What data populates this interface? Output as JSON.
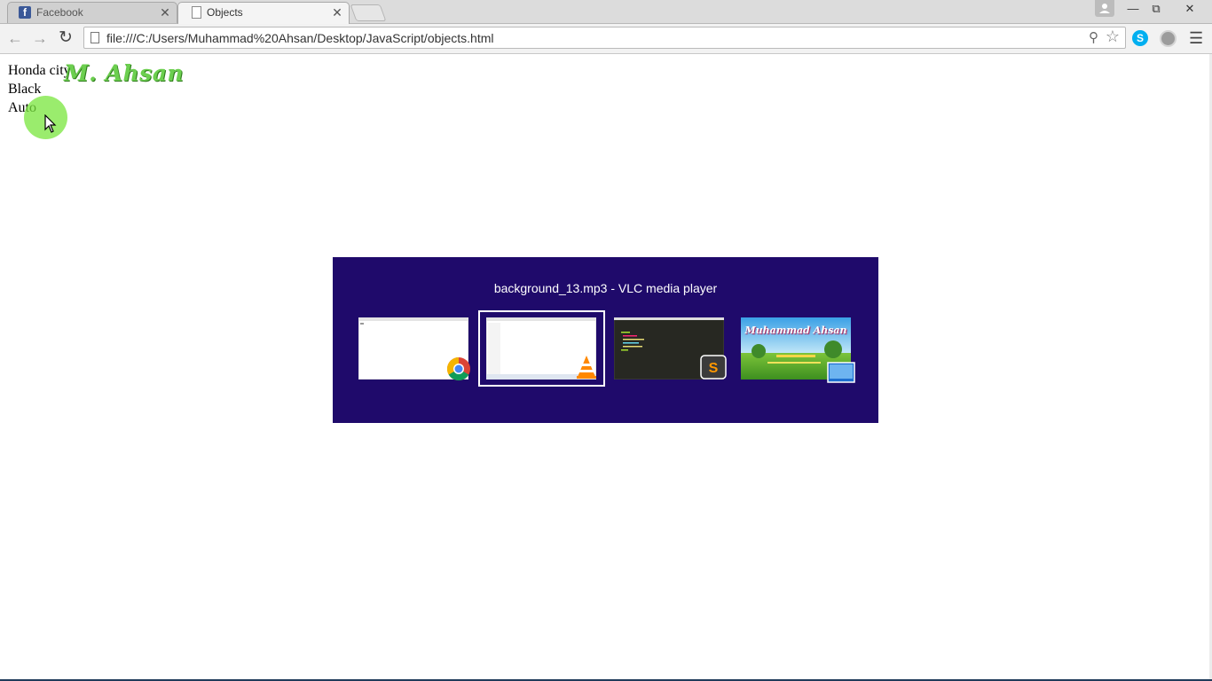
{
  "browser": {
    "tabs": [
      {
        "title": "Facebook",
        "favicon": "facebook-icon",
        "active": false
      },
      {
        "title": "Objects",
        "favicon": "page-icon",
        "active": true
      }
    ],
    "address_url": "file:///C:/Users/Muhammad%20Ahsan/Desktop/JavaScript/objects.html",
    "accent_skype": "#00aff0"
  },
  "page": {
    "lines": [
      "Honda city",
      "Black",
      "Auto"
    ],
    "watermark": "M. Ahsan"
  },
  "switcher": {
    "title": "background_13.mp3 - VLC media player",
    "background": "#1f0a6b",
    "windows": [
      {
        "app": "chrome-icon",
        "selected": false
      },
      {
        "app": "vlc-icon",
        "selected": true
      },
      {
        "app": "sublime-icon",
        "selected": false
      },
      {
        "app": "desktop-icon",
        "selected": false,
        "banner": "Muhammad Ahsan"
      }
    ]
  }
}
